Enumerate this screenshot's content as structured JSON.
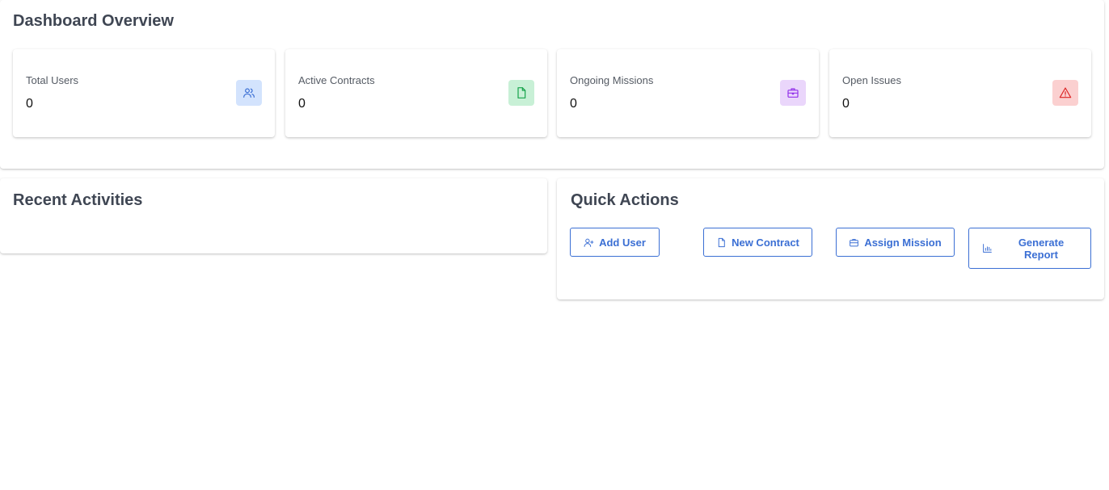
{
  "overview": {
    "title": "Dashboard Overview",
    "stats": [
      {
        "label": "Total Users",
        "value": "0",
        "icon": "users-icon",
        "bg": "#d3e3fd",
        "color": "#3b6fd4"
      },
      {
        "label": "Active Contracts",
        "value": "0",
        "icon": "document-icon",
        "bg": "#c8f0d6",
        "color": "#16a34a"
      },
      {
        "label": "Ongoing Missions",
        "value": "0",
        "icon": "briefcase-icon",
        "bg": "#ead6fb",
        "color": "#9333ea"
      },
      {
        "label": "Open Issues",
        "value": "0",
        "icon": "warning-icon",
        "bg": "#fbd0d0",
        "color": "#dc2626"
      }
    ]
  },
  "activities": {
    "title": "Recent Activities"
  },
  "quick_actions": {
    "title": "Quick Actions",
    "buttons": [
      {
        "label": "Add User",
        "icon": "add-user-icon"
      },
      {
        "label": "New Contract",
        "icon": "document-icon"
      },
      {
        "label": "Assign Mission",
        "icon": "briefcase-icon"
      },
      {
        "label": "Generate Report",
        "icon": "chart-icon"
      }
    ]
  },
  "colors": {
    "accent": "#3b6fd4"
  }
}
